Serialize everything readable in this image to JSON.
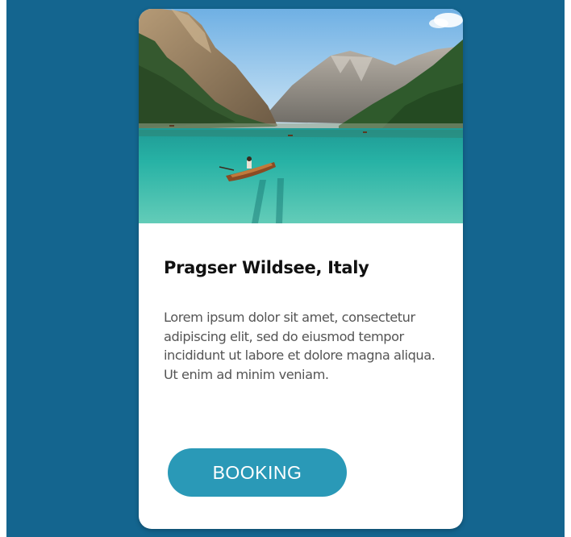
{
  "card": {
    "title": "Pragser Wildsee, Italy",
    "description": "Lorem ipsum dolor sit amet, consectetur adipiscing elit, sed do eiusmod tempor incididunt ut labore et dolore magna aliqua. Ut enim ad minim veniam.",
    "button_label": "BOOKING",
    "photo_icon": "lake-mountain-photo"
  },
  "colors": {
    "backdrop": "#14658f",
    "card": "#ffffff",
    "button": "#2a99b7",
    "title": "#111111",
    "text": "#555555"
  }
}
